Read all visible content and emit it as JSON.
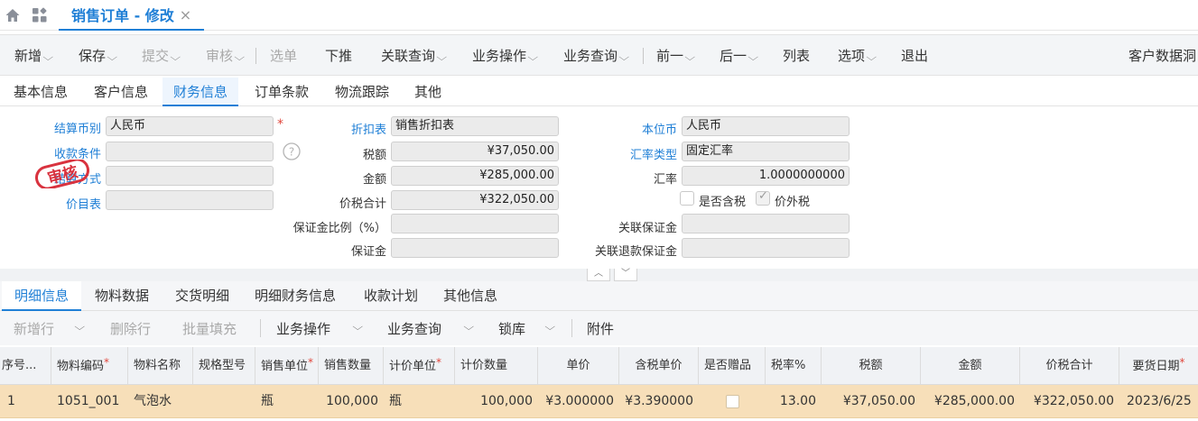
{
  "tab": {
    "title": "销售订单 - 修改",
    "close": "×"
  },
  "toolbar": {
    "items": [
      {
        "label": "新增",
        "arrow": true,
        "disabled": false
      },
      {
        "label": "保存",
        "arrow": true,
        "disabled": false
      },
      {
        "label": "提交",
        "arrow": true,
        "disabled": true
      },
      {
        "label": "审核",
        "arrow": true,
        "disabled": true
      },
      {
        "label": "选单",
        "arrow": false,
        "disabled": true
      },
      {
        "label": "下推",
        "arrow": false,
        "disabled": false
      },
      {
        "label": "关联查询",
        "arrow": true,
        "disabled": false
      },
      {
        "label": "业务操作",
        "arrow": true,
        "disabled": false
      },
      {
        "label": "业务查询",
        "arrow": true,
        "disabled": false
      },
      {
        "label": "前一",
        "arrow": true,
        "disabled": false
      },
      {
        "label": "后一",
        "arrow": true,
        "disabled": false
      },
      {
        "label": "列表",
        "arrow": false,
        "disabled": false
      },
      {
        "label": "选项",
        "arrow": true,
        "disabled": false
      },
      {
        "label": "退出",
        "arrow": false,
        "disabled": false
      }
    ],
    "right_text": "客户数据洞"
  },
  "section_tabs": [
    "基本信息",
    "客户信息",
    "财务信息",
    "订单条款",
    "物流跟踪",
    "其他"
  ],
  "section_active": "财务信息",
  "form": {
    "settle_currency": {
      "label": "结算币别",
      "value": "人民币"
    },
    "payment_terms": {
      "label": "收款条件",
      "value": ""
    },
    "settle_method": {
      "label": "结算方式",
      "value": ""
    },
    "price_list": {
      "label": "价目表",
      "value": ""
    },
    "discount_table": {
      "label": "折扣表",
      "value": "销售折扣表"
    },
    "tax_amount": {
      "label": "税额",
      "value": "¥37,050.00"
    },
    "amount": {
      "label": "金额",
      "value": "¥285,000.00"
    },
    "total_with_tax": {
      "label": "价税合计",
      "value": "¥322,050.00"
    },
    "deposit_ratio": {
      "label": "保证金比例（%）",
      "value": ""
    },
    "deposit": {
      "label": "保证金",
      "value": ""
    },
    "local_currency": {
      "label": "本位币",
      "value": "人民币"
    },
    "rate_type": {
      "label": "汇率类型",
      "value": "固定汇率"
    },
    "exchange_rate": {
      "label": "汇率",
      "value": "1.0000000000"
    },
    "tax_included": {
      "label": "是否含税",
      "checked": false
    },
    "tax_excluded": {
      "label": "价外税",
      "checked": true
    },
    "linked_deposit": {
      "label": "关联保证金",
      "value": ""
    },
    "linked_refund_deposit": {
      "label": "关联退款保证金",
      "value": ""
    },
    "help": "?",
    "stamp_text": "审核"
  },
  "detail_tabs": [
    "明细信息",
    "物料数据",
    "交货明细",
    "明细财务信息",
    "收款计划",
    "其他信息"
  ],
  "detail_active": "明细信息",
  "detail_toolbar": {
    "add_row": "新增行",
    "delete_row": "删除行",
    "batch_fill": "批量填充",
    "business_ops": "业务操作",
    "business_query": "业务查询",
    "lock_stock": "锁库",
    "attachment": "附件"
  },
  "grid": {
    "columns": [
      "序号...",
      "物料编码",
      "物料名称",
      "规格型号",
      "销售单位",
      "销售数量",
      "计价单位",
      "计价数量",
      "单价",
      "含税单价",
      "是否赠品",
      "税率%",
      "税额",
      "金额",
      "价税合计",
      "要货日期"
    ],
    "rows": [
      {
        "seq": "1",
        "code": "1051_001",
        "name": "气泡水",
        "spec": "",
        "sale_unit": "瓶",
        "sale_qty": "100,000",
        "price_unit": "瓶",
        "price_qty": "100,000",
        "unit_price": "¥3.000000",
        "tax_unit_price": "¥3.390000",
        "gift": false,
        "tax_rate": "13.00",
        "tax": "¥37,050.00",
        "amount": "¥285,000.00",
        "total": "¥322,050.00",
        "date": "2023/6/25"
      }
    ]
  },
  "colors": {
    "accent": "#1f7fd6",
    "required": "#e0463b",
    "selected_row": "#f7dfb9",
    "stamp": "#d9333f"
  }
}
